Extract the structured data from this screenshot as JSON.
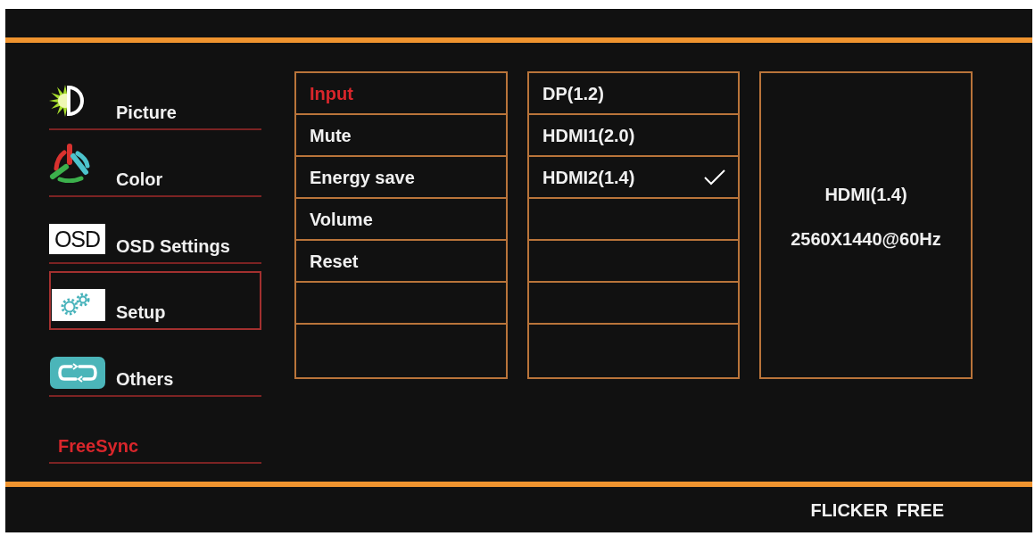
{
  "sidebar": {
    "items": [
      {
        "kind": "icon",
        "label": "Picture",
        "selected": false
      },
      {
        "kind": "icon",
        "label": "Color",
        "selected": false
      },
      {
        "kind": "tile",
        "tile_text": "OSD",
        "label": "OSD Settings",
        "selected": false
      },
      {
        "kind": "icon",
        "label": "Setup",
        "selected": true
      },
      {
        "kind": "icon",
        "label": "Others",
        "selected": false
      },
      {
        "kind": "label",
        "label": "FreeSync",
        "selected": false
      }
    ]
  },
  "submenu": {
    "items": [
      {
        "label": "Input",
        "selected": true
      },
      {
        "label": "Mute",
        "selected": false
      },
      {
        "label": "Energy save",
        "selected": false
      },
      {
        "label": "Volume",
        "selected": false
      },
      {
        "label": "Reset",
        "selected": false
      }
    ]
  },
  "options": {
    "items": [
      {
        "label": "DP(1.2)",
        "checked": false
      },
      {
        "label": "HDMI1(2.0)",
        "checked": false
      },
      {
        "label": "HDMI2(1.4)",
        "checked": true
      }
    ]
  },
  "info": {
    "lines": [
      "HDMI(1.4)",
      "2560X1440@60Hz"
    ]
  },
  "footer": {
    "label": "FLICKER FREE"
  }
}
